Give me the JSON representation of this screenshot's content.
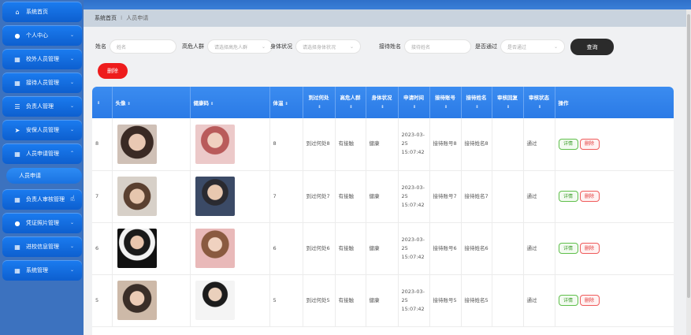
{
  "sidebar": {
    "items": [
      {
        "label": "系统首页",
        "icon": "home-icon",
        "chev": ""
      },
      {
        "label": "个人中心",
        "icon": "user-icon",
        "chev": "⌄"
      },
      {
        "label": "校外人员管理",
        "icon": "grid-icon",
        "chev": "⌄"
      },
      {
        "label": "接待人员管理",
        "icon": "grid-icon",
        "chev": "⌄"
      },
      {
        "label": "负责人管理",
        "icon": "list-icon",
        "chev": "⌄"
      },
      {
        "label": "安保人员管理",
        "icon": "send-icon",
        "chev": "⌄"
      },
      {
        "label": "人员申请管理",
        "icon": "grid-icon",
        "chev": "⌃"
      },
      {
        "label": "负责人审核管理",
        "icon": "grid-icon",
        "chev": "⌄"
      },
      {
        "label": "凭证照片管理",
        "icon": "user-icon",
        "chev": "⌄"
      },
      {
        "label": "进校信息管理",
        "icon": "grid-icon",
        "chev": "⌄"
      },
      {
        "label": "系统管理",
        "icon": "grid-icon",
        "chev": "⌄"
      }
    ],
    "sub_active": "人员申请"
  },
  "breadcrumb": {
    "home": "系统首页",
    "sep": "⁝",
    "current": "人员申请"
  },
  "search": {
    "name_label": "姓名",
    "name_placeholder": "姓名",
    "crowd_label": "高危人群",
    "crowd_placeholder": "请选择高危人群",
    "health_label": "身体状况",
    "health_placeholder": "请选择身体状况",
    "host_label": "接待姓名",
    "host_placeholder": "接待姓名",
    "pass_label": "是否通过",
    "pass_placeholder": "是否通过",
    "query_label": "查询"
  },
  "delete_label": "删除",
  "table": {
    "headers": [
      "头像",
      "健康码",
      "体温",
      "到过何处",
      "高危人群",
      "身体状况",
      "申请时间",
      "接待账号",
      "接待姓名",
      "审核回复",
      "审核状态",
      "操作"
    ],
    "detail_label": "详情",
    "del_label": "删除",
    "rows": [
      {
        "idx": "8",
        "temp": "8",
        "place": "到过何处8",
        "crowd": "有接触",
        "health": "健康",
        "time": "2023-03-25 15:07:42",
        "acct": "接待账号8",
        "host": "接待姓名8",
        "reply": "",
        "status": "通过"
      },
      {
        "idx": "7",
        "temp": "7",
        "place": "到过何处7",
        "crowd": "有接触",
        "health": "健康",
        "time": "2023-03-25 15:07:42",
        "acct": "接待账号7",
        "host": "接待姓名7",
        "reply": "",
        "status": "通过"
      },
      {
        "idx": "6",
        "temp": "6",
        "place": "到过何处6",
        "crowd": "有接触",
        "health": "健康",
        "time": "2023-03-25 15:07:42",
        "acct": "接待账号6",
        "host": "接待姓名6",
        "reply": "",
        "status": "通过"
      },
      {
        "idx": "5",
        "temp": "5",
        "place": "到过何处5",
        "crowd": "有接触",
        "health": "健康",
        "time": "2023-03-25 15:07:42",
        "acct": "接待账号5",
        "host": "接待姓名5",
        "reply": "",
        "status": "通过"
      }
    ]
  }
}
